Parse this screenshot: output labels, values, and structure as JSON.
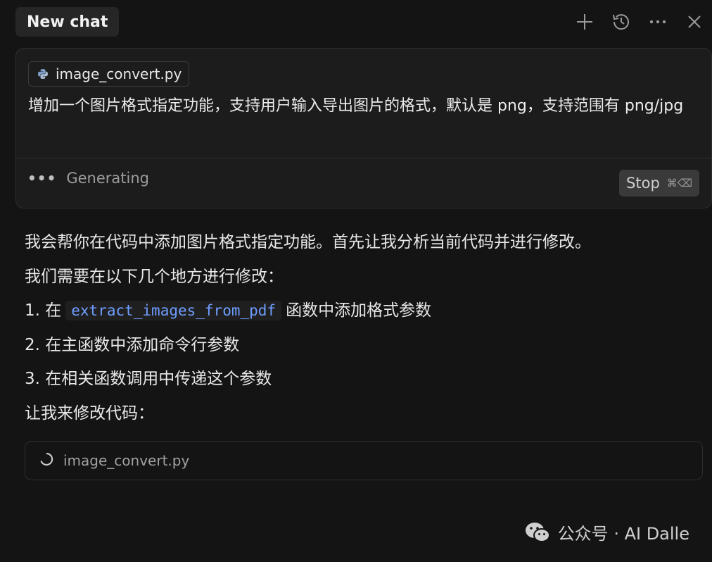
{
  "header": {
    "tab_label": "New chat",
    "icons": [
      "plus-icon",
      "history-icon",
      "more-icon",
      "close-icon"
    ]
  },
  "prompt": {
    "file_chip": "image_convert.py",
    "text": "增加一个图片格式指定功能，支持用户输入导出图片的格式，默认是 png，支持范围有 png/jpg",
    "status": "Generating",
    "stop_label": "Stop",
    "stop_shortcut": "⌘⌫"
  },
  "response": {
    "intro": "我会帮你在代码中添加图片格式指定功能。首先让我分析当前代码并进行修改。",
    "lead": "我们需要在以下几个地方进行修改：",
    "step1_prefix": "1. 在",
    "step1_code": "extract_images_from_pdf",
    "step1_suffix": "函数中添加格式参数",
    "step2": "2. 在主函数中添加命令行参数",
    "step3": "3. 在相关函数调用中传递这个参数",
    "closing": "让我来修改代码：",
    "file_status": "image_convert.py"
  },
  "watermark": {
    "text": "公众号 · AI Dalle"
  },
  "colors": {
    "background": "#141414",
    "card": "#1c1c1c",
    "code_accent": "#6f9dff"
  }
}
